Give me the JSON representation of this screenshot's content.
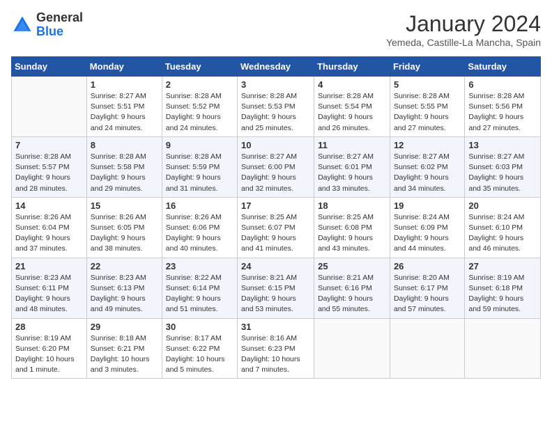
{
  "logo": {
    "general": "General",
    "blue": "Blue"
  },
  "header": {
    "title": "January 2024",
    "subtitle": "Yemeda, Castille-La Mancha, Spain"
  },
  "weekdays": [
    "Sunday",
    "Monday",
    "Tuesday",
    "Wednesday",
    "Thursday",
    "Friday",
    "Saturday"
  ],
  "weeks": [
    [
      {
        "day": "",
        "sunrise": "",
        "sunset": "",
        "daylight": ""
      },
      {
        "day": "1",
        "sunrise": "Sunrise: 8:27 AM",
        "sunset": "Sunset: 5:51 PM",
        "daylight": "Daylight: 9 hours and 24 minutes."
      },
      {
        "day": "2",
        "sunrise": "Sunrise: 8:28 AM",
        "sunset": "Sunset: 5:52 PM",
        "daylight": "Daylight: 9 hours and 24 minutes."
      },
      {
        "day": "3",
        "sunrise": "Sunrise: 8:28 AM",
        "sunset": "Sunset: 5:53 PM",
        "daylight": "Daylight: 9 hours and 25 minutes."
      },
      {
        "day": "4",
        "sunrise": "Sunrise: 8:28 AM",
        "sunset": "Sunset: 5:54 PM",
        "daylight": "Daylight: 9 hours and 26 minutes."
      },
      {
        "day": "5",
        "sunrise": "Sunrise: 8:28 AM",
        "sunset": "Sunset: 5:55 PM",
        "daylight": "Daylight: 9 hours and 27 minutes."
      },
      {
        "day": "6",
        "sunrise": "Sunrise: 8:28 AM",
        "sunset": "Sunset: 5:56 PM",
        "daylight": "Daylight: 9 hours and 27 minutes."
      }
    ],
    [
      {
        "day": "7",
        "sunrise": "Sunrise: 8:28 AM",
        "sunset": "Sunset: 5:57 PM",
        "daylight": "Daylight: 9 hours and 28 minutes."
      },
      {
        "day": "8",
        "sunrise": "Sunrise: 8:28 AM",
        "sunset": "Sunset: 5:58 PM",
        "daylight": "Daylight: 9 hours and 29 minutes."
      },
      {
        "day": "9",
        "sunrise": "Sunrise: 8:28 AM",
        "sunset": "Sunset: 5:59 PM",
        "daylight": "Daylight: 9 hours and 31 minutes."
      },
      {
        "day": "10",
        "sunrise": "Sunrise: 8:27 AM",
        "sunset": "Sunset: 6:00 PM",
        "daylight": "Daylight: 9 hours and 32 minutes."
      },
      {
        "day": "11",
        "sunrise": "Sunrise: 8:27 AM",
        "sunset": "Sunset: 6:01 PM",
        "daylight": "Daylight: 9 hours and 33 minutes."
      },
      {
        "day": "12",
        "sunrise": "Sunrise: 8:27 AM",
        "sunset": "Sunset: 6:02 PM",
        "daylight": "Daylight: 9 hours and 34 minutes."
      },
      {
        "day": "13",
        "sunrise": "Sunrise: 8:27 AM",
        "sunset": "Sunset: 6:03 PM",
        "daylight": "Daylight: 9 hours and 35 minutes."
      }
    ],
    [
      {
        "day": "14",
        "sunrise": "Sunrise: 8:26 AM",
        "sunset": "Sunset: 6:04 PM",
        "daylight": "Daylight: 9 hours and 37 minutes."
      },
      {
        "day": "15",
        "sunrise": "Sunrise: 8:26 AM",
        "sunset": "Sunset: 6:05 PM",
        "daylight": "Daylight: 9 hours and 38 minutes."
      },
      {
        "day": "16",
        "sunrise": "Sunrise: 8:26 AM",
        "sunset": "Sunset: 6:06 PM",
        "daylight": "Daylight: 9 hours and 40 minutes."
      },
      {
        "day": "17",
        "sunrise": "Sunrise: 8:25 AM",
        "sunset": "Sunset: 6:07 PM",
        "daylight": "Daylight: 9 hours and 41 minutes."
      },
      {
        "day": "18",
        "sunrise": "Sunrise: 8:25 AM",
        "sunset": "Sunset: 6:08 PM",
        "daylight": "Daylight: 9 hours and 43 minutes."
      },
      {
        "day": "19",
        "sunrise": "Sunrise: 8:24 AM",
        "sunset": "Sunset: 6:09 PM",
        "daylight": "Daylight: 9 hours and 44 minutes."
      },
      {
        "day": "20",
        "sunrise": "Sunrise: 8:24 AM",
        "sunset": "Sunset: 6:10 PM",
        "daylight": "Daylight: 9 hours and 46 minutes."
      }
    ],
    [
      {
        "day": "21",
        "sunrise": "Sunrise: 8:23 AM",
        "sunset": "Sunset: 6:11 PM",
        "daylight": "Daylight: 9 hours and 48 minutes."
      },
      {
        "day": "22",
        "sunrise": "Sunrise: 8:23 AM",
        "sunset": "Sunset: 6:13 PM",
        "daylight": "Daylight: 9 hours and 49 minutes."
      },
      {
        "day": "23",
        "sunrise": "Sunrise: 8:22 AM",
        "sunset": "Sunset: 6:14 PM",
        "daylight": "Daylight: 9 hours and 51 minutes."
      },
      {
        "day": "24",
        "sunrise": "Sunrise: 8:21 AM",
        "sunset": "Sunset: 6:15 PM",
        "daylight": "Daylight: 9 hours and 53 minutes."
      },
      {
        "day": "25",
        "sunrise": "Sunrise: 8:21 AM",
        "sunset": "Sunset: 6:16 PM",
        "daylight": "Daylight: 9 hours and 55 minutes."
      },
      {
        "day": "26",
        "sunrise": "Sunrise: 8:20 AM",
        "sunset": "Sunset: 6:17 PM",
        "daylight": "Daylight: 9 hours and 57 minutes."
      },
      {
        "day": "27",
        "sunrise": "Sunrise: 8:19 AM",
        "sunset": "Sunset: 6:18 PM",
        "daylight": "Daylight: 9 hours and 59 minutes."
      }
    ],
    [
      {
        "day": "28",
        "sunrise": "Sunrise: 8:19 AM",
        "sunset": "Sunset: 6:20 PM",
        "daylight": "Daylight: 10 hours and 1 minute."
      },
      {
        "day": "29",
        "sunrise": "Sunrise: 8:18 AM",
        "sunset": "Sunset: 6:21 PM",
        "daylight": "Daylight: 10 hours and 3 minutes."
      },
      {
        "day": "30",
        "sunrise": "Sunrise: 8:17 AM",
        "sunset": "Sunset: 6:22 PM",
        "daylight": "Daylight: 10 hours and 5 minutes."
      },
      {
        "day": "31",
        "sunrise": "Sunrise: 8:16 AM",
        "sunset": "Sunset: 6:23 PM",
        "daylight": "Daylight: 10 hours and 7 minutes."
      },
      {
        "day": "",
        "sunrise": "",
        "sunset": "",
        "daylight": ""
      },
      {
        "day": "",
        "sunrise": "",
        "sunset": "",
        "daylight": ""
      },
      {
        "day": "",
        "sunrise": "",
        "sunset": "",
        "daylight": ""
      }
    ]
  ]
}
